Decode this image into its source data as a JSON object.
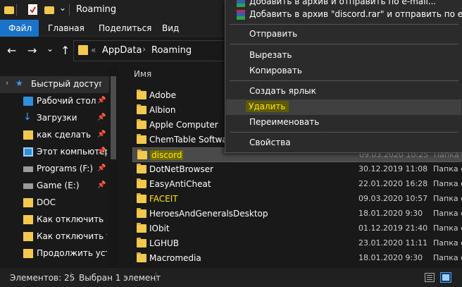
{
  "window": {
    "title": "Roaming"
  },
  "ribbon": {
    "tabs": [
      "Файл",
      "Главная",
      "Поделиться",
      "Вид"
    ]
  },
  "nav": {
    "back": "←",
    "forward": "→",
    "dropdown": "⌄",
    "up": "↑"
  },
  "address": {
    "chevrons": "«",
    "parts": [
      "AppData",
      "Roaming"
    ],
    "sep": "›"
  },
  "sidebar": {
    "items": [
      {
        "label": "Быстрый доступ",
        "icon": "star-icon",
        "pinned": false
      },
      {
        "label": "Рабочий стол",
        "icon": "desktop-icon",
        "pinned": true
      },
      {
        "label": "Загрузки",
        "icon": "download-icon",
        "pinned": true
      },
      {
        "label": "как сделать",
        "icon": "folder-icon",
        "pinned": true
      },
      {
        "label": "Этот компьютер",
        "icon": "computer-icon",
        "pinned": true
      },
      {
        "label": "Programs (F:)",
        "icon": "drive-icon",
        "pinned": true
      },
      {
        "label": "Game (E:)",
        "icon": "drive-icon",
        "pinned": true
      },
      {
        "label": "DOC",
        "icon": "folder-icon",
        "pinned": false
      },
      {
        "label": "Как отключить ил",
        "icon": "folder-icon",
        "pinned": false
      },
      {
        "label": "Как отключить тел",
        "icon": "folder-icon",
        "pinned": false
      },
      {
        "label": "Продолжить устан",
        "icon": "folder-icon",
        "pinned": false
      }
    ],
    "pin_glyph": "📌"
  },
  "filelist": {
    "header_name": "Имя",
    "rows": [
      {
        "name": "Adobe",
        "date": "",
        "type": ""
      },
      {
        "name": "Albion",
        "date": "",
        "type": ""
      },
      {
        "name": "Apple Computer",
        "date": "",
        "type": ""
      },
      {
        "name": "ChemTable Software",
        "date": "",
        "type": ""
      },
      {
        "name": "discord",
        "date": "09.03.2020 10:25",
        "type": "Папка с",
        "selected": true
      },
      {
        "name": "DotNetBrowser",
        "date": "30.12.2019 11:08",
        "type": "Папка с"
      },
      {
        "name": "EasyAntiCheat",
        "date": "22.01.2020 16:28",
        "type": "Папка с"
      },
      {
        "name": "FACEIT",
        "date": "09.03.2020 10:57",
        "type": "Папка с"
      },
      {
        "name": "HeroesAndGeneralsDesktop",
        "date": "18.01.2020 9:30",
        "type": "Папка с"
      },
      {
        "name": "IObit",
        "date": "01.12.2019 21:40",
        "type": "Папка с"
      },
      {
        "name": "LGHUB",
        "date": "23.01.2020 11:11",
        "type": "Папка с"
      },
      {
        "name": "Macromedia",
        "date": "18.01.2020 9:30",
        "type": "Папка с"
      }
    ]
  },
  "context_menu": {
    "items": [
      {
        "label": "Добавить в архив и отправить по e-mail...",
        "icon": "winrar-icon"
      },
      {
        "label": "Добавить в архив \"discord.rar\" и отправить по e-mail",
        "icon": "winrar-icon"
      },
      {
        "label": "Отправить"
      },
      {
        "label": "Вырезать"
      },
      {
        "label": "Копировать"
      },
      {
        "label": "Создать ярлык"
      },
      {
        "label": "Удалить",
        "highlighted": true
      },
      {
        "label": "Переименовать"
      },
      {
        "label": "Свойства"
      }
    ]
  },
  "status": {
    "count": "Элементов: 25",
    "selected": "Выбран 1 элемент"
  },
  "colors": {
    "accent": "#1a73c9",
    "highlight_text": "#ffe600",
    "folder": "#f2c94c"
  }
}
